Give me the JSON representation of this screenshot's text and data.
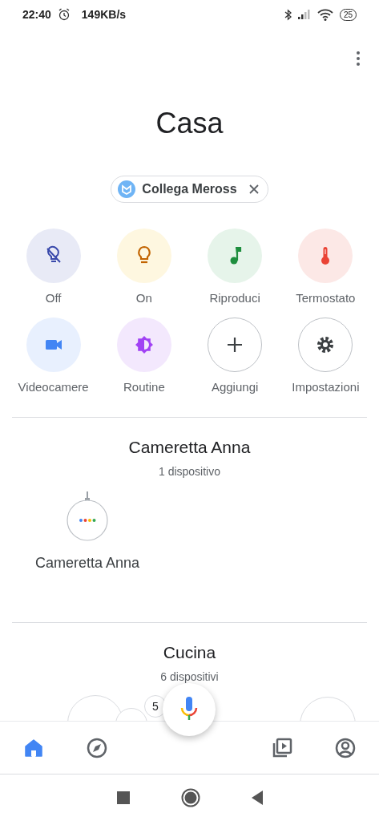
{
  "status_bar": {
    "time": "22:40",
    "speed": "149KB/s",
    "battery": "25"
  },
  "title": "Casa",
  "chip": {
    "label": "Collega Meross"
  },
  "actions": [
    {
      "label": "Off",
      "kind": "lights-off"
    },
    {
      "label": "On",
      "kind": "lights-on"
    },
    {
      "label": "Riproduci",
      "kind": "play"
    },
    {
      "label": "Termostato",
      "kind": "thermostat"
    },
    {
      "label": "Videocamere",
      "kind": "cameras"
    },
    {
      "label": "Routine",
      "kind": "routine"
    },
    {
      "label": "Aggiungi",
      "kind": "add"
    },
    {
      "label": "Impostazioni",
      "kind": "settings"
    }
  ],
  "rooms": [
    {
      "name": "Cameretta Anna",
      "count": "1 dispositivo",
      "devices": [
        {
          "name": "Cameretta Anna"
        }
      ]
    },
    {
      "name": "Cucina",
      "count": "6 dispositivi",
      "badge": "5"
    }
  ],
  "bottom_nav": [
    {
      "kind": "home",
      "selected": true
    },
    {
      "kind": "discover",
      "selected": false
    },
    {
      "kind": "media",
      "selected": false
    },
    {
      "kind": "account",
      "selected": false
    }
  ]
}
